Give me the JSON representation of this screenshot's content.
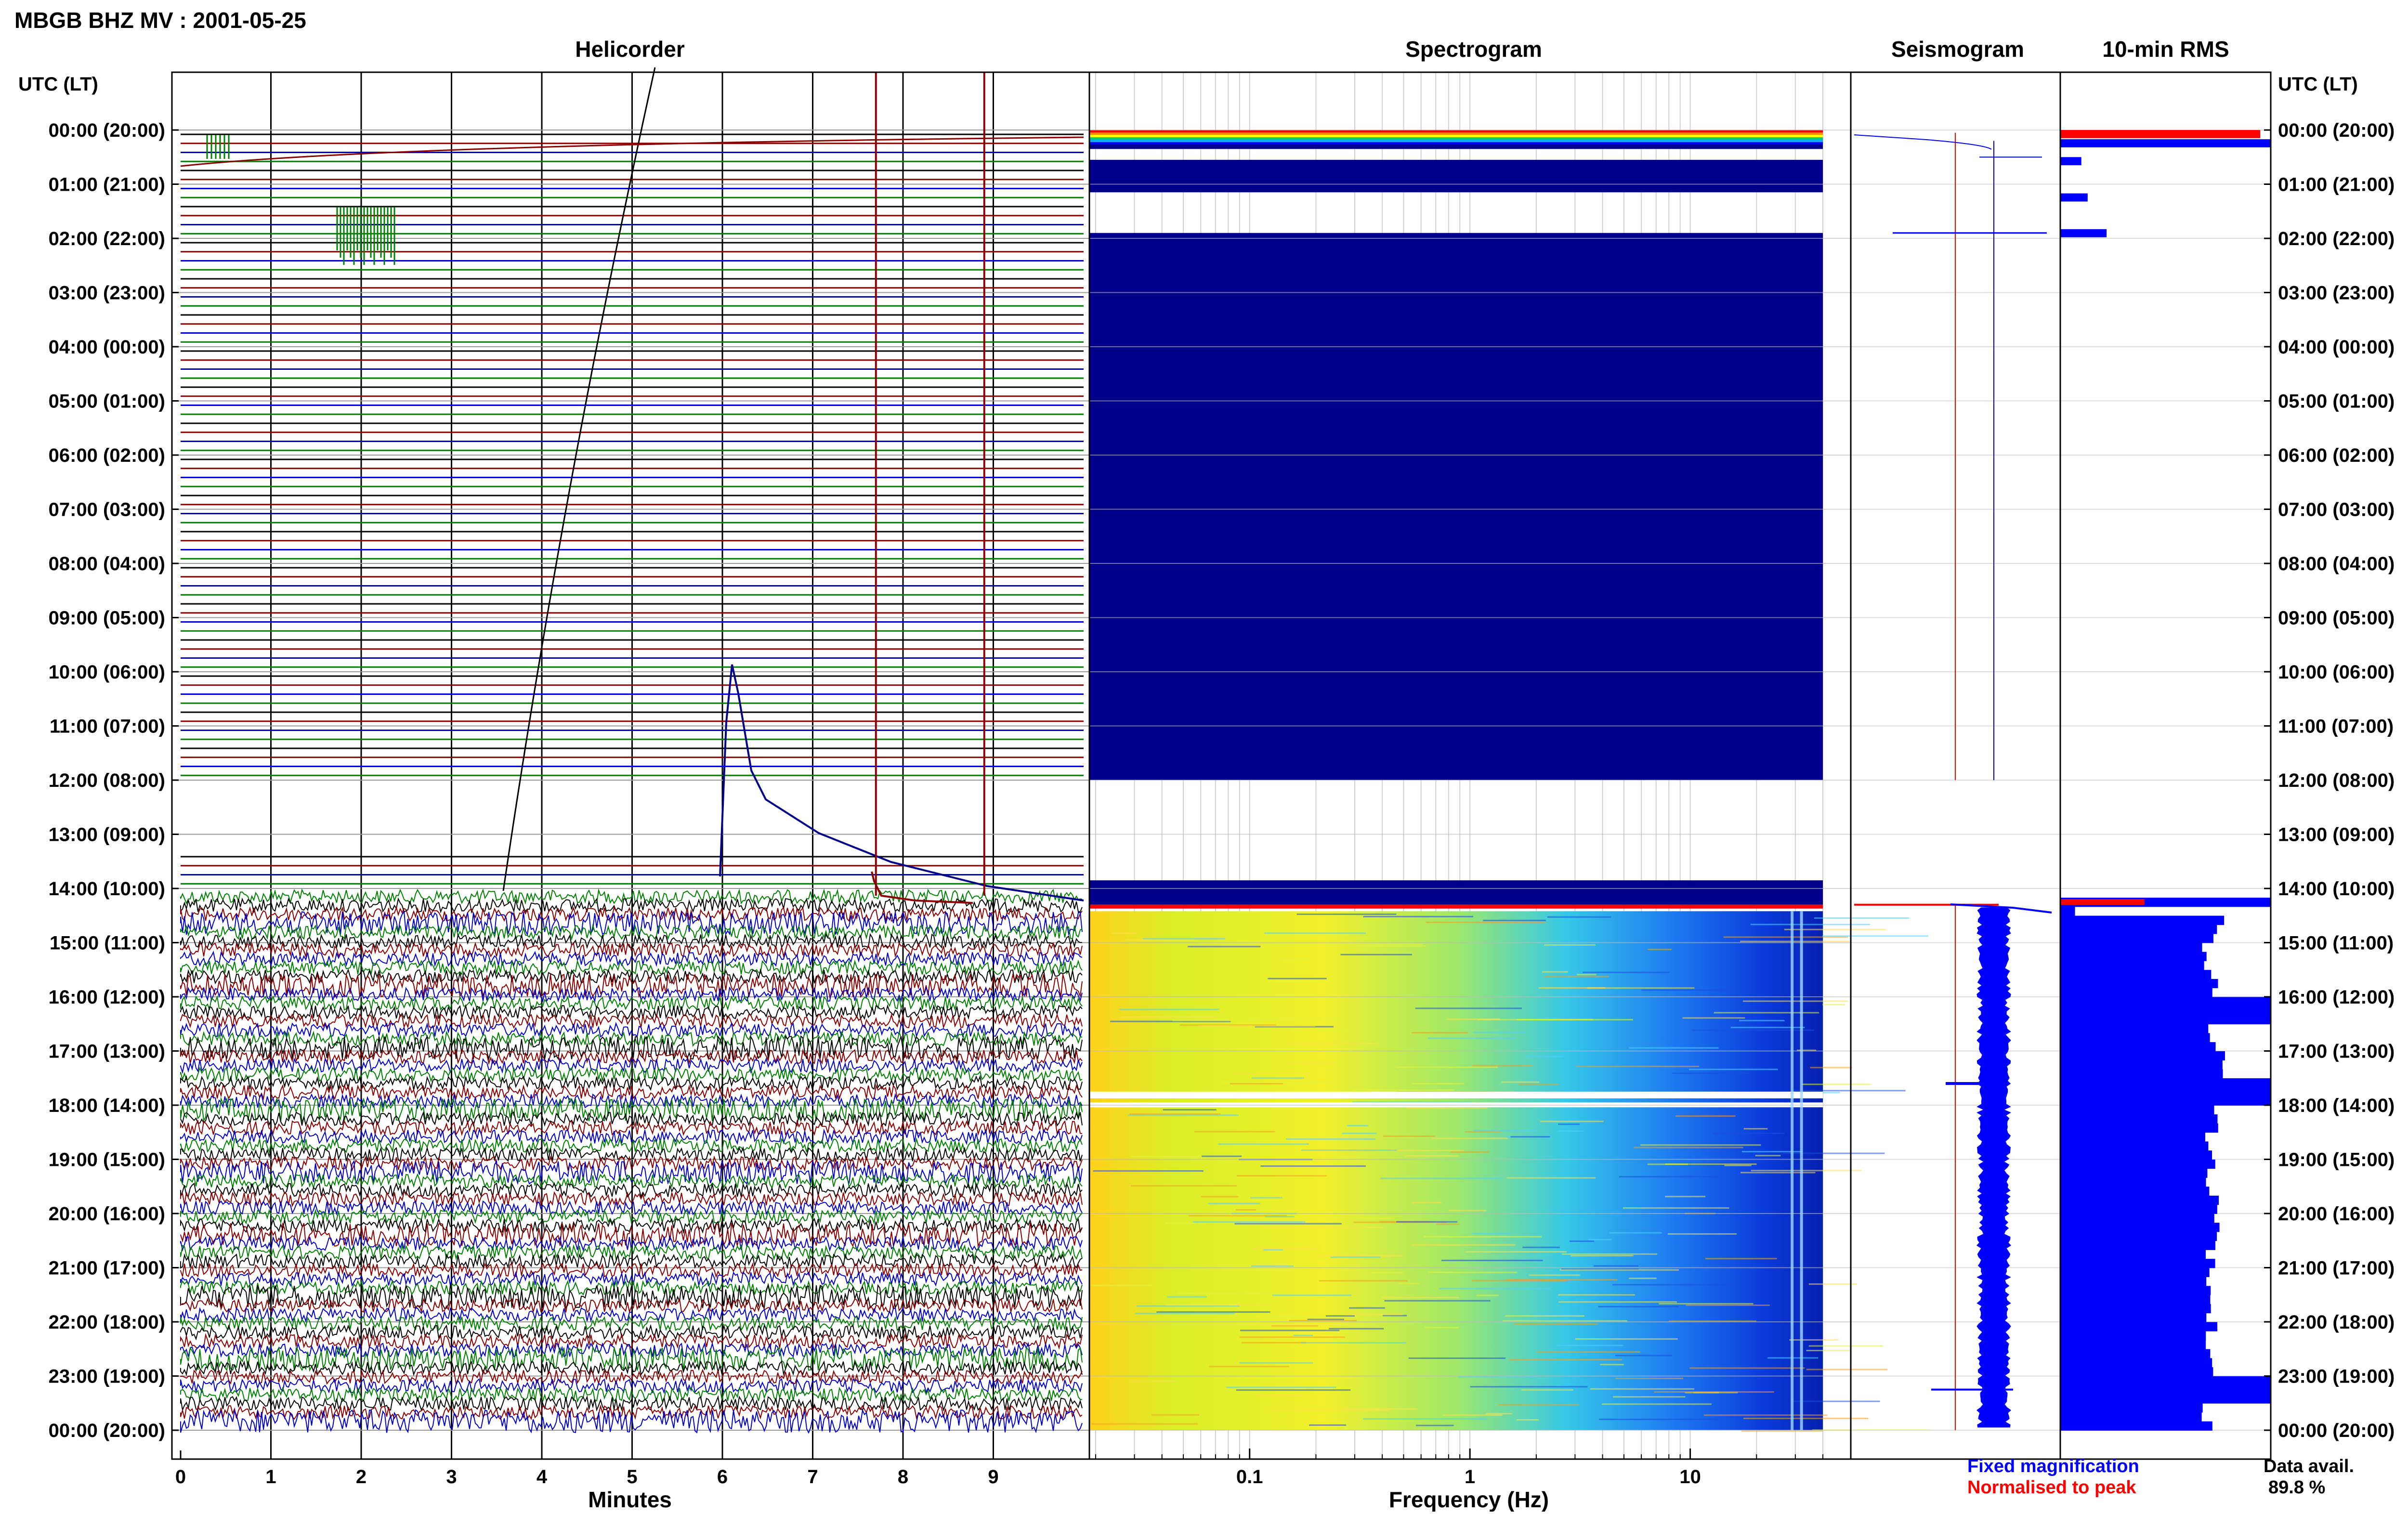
{
  "header": {
    "title": "MBGB BHZ MV : 2001-05-25"
  },
  "panels": {
    "helicorder": "Helicorder",
    "spectrogram": "Spectrogram",
    "seismogram": "Seismogram",
    "rms": "10-min RMS"
  },
  "axes": {
    "left_header": "UTC (LT)",
    "right_header": "UTC (LT)",
    "helicorder_xlabel": "Minutes",
    "spectrogram_xlabel": "Frequency (Hz)"
  },
  "legend": {
    "fixed": "Fixed magnification",
    "normalised": "Normalised to peak",
    "fixed_color": "#0000ff",
    "normalised_color": "#ff0000"
  },
  "data_avail": {
    "label": "Data avail.",
    "value": "89.8 %"
  },
  "colors": {
    "trace_palette": [
      "#000000",
      "#8b0000",
      "#0000cd",
      "#008000"
    ],
    "spectrogram_background": "#00008b",
    "rms_bar": "#0000ff",
    "rms_peak": "#ff0000"
  },
  "chart_data": {
    "time_labels": [
      "00:00 (20:00)",
      "01:00 (21:00)",
      "02:00 (22:00)",
      "03:00 (23:00)",
      "04:00 (00:00)",
      "05:00 (01:00)",
      "06:00 (02:00)",
      "07:00 (03:00)",
      "08:00 (04:00)",
      "09:00 (05:00)",
      "10:00 (06:00)",
      "11:00 (07:00)",
      "12:00 (08:00)",
      "13:00 (09:00)",
      "14:00 (10:00)",
      "15:00 (11:00)",
      "16:00 (12:00)",
      "17:00 (13:00)",
      "18:00 (14:00)",
      "19:00 (15:00)",
      "20:00 (16:00)",
      "21:00 (17:00)",
      "22:00 (18:00)",
      "23:00 (19:00)",
      "00:00 (20:00)"
    ],
    "minute_ticks": [
      "0",
      "1",
      "2",
      "3",
      "4",
      "5",
      "6",
      "7",
      "8",
      "9"
    ],
    "minute_lines": [
      7.7,
      8.9
    ],
    "frequency_ticks": [
      "0.1",
      "1",
      "10"
    ],
    "frequency_range_hz": [
      0.02,
      40
    ],
    "rms_10min": {
      "type": "bar",
      "units": "relative",
      "segments": [
        {
          "hour": 0.0,
          "value": 0.95,
          "color": "red"
        },
        {
          "hour": 0.17,
          "value": 1.0,
          "color": "blue"
        },
        {
          "hour": 0.5,
          "value": 0.1,
          "color": "blue"
        },
        {
          "hour": 1.17,
          "value": 0.13,
          "color": "blue"
        },
        {
          "hour": 1.83,
          "value": 0.22,
          "color": "blue"
        },
        {
          "hour": 14.0,
          "value": 0.4,
          "color": "red"
        },
        {
          "hour": 14.17,
          "value": 1.0,
          "color": "blue"
        },
        {
          "hour": 14.33,
          "value": 0.07,
          "color": "red"
        },
        {
          "hour": 14.5,
          "value": 0.75,
          "color": "blue"
        },
        {
          "hour": 15.0,
          "value": 0.7,
          "color": "blue"
        },
        {
          "hour": 15.5,
          "value": 0.72,
          "color": "blue"
        },
        {
          "hour": 16.0,
          "value": 1.0,
          "color": "blue"
        },
        {
          "hour": 16.5,
          "value": 0.73,
          "color": "blue"
        },
        {
          "hour": 17.0,
          "value": 0.76,
          "color": "blue"
        },
        {
          "hour": 17.5,
          "value": 1.0,
          "color": "blue"
        },
        {
          "hour": 18.0,
          "value": 0.74,
          "color": "blue"
        },
        {
          "hour": 18.5,
          "value": 0.71,
          "color": "blue"
        },
        {
          "hour": 19.0,
          "value": 0.72,
          "color": "blue"
        },
        {
          "hour": 19.5,
          "value": 0.73,
          "color": "blue"
        },
        {
          "hour": 20.0,
          "value": 0.76,
          "color": "blue"
        },
        {
          "hour": 20.5,
          "value": 0.72,
          "color": "blue"
        },
        {
          "hour": 21.0,
          "value": 0.7,
          "color": "blue"
        },
        {
          "hour": 21.5,
          "value": 0.71,
          "color": "blue"
        },
        {
          "hour": 22.0,
          "value": 0.72,
          "color": "blue"
        },
        {
          "hour": 22.5,
          "value": 0.7,
          "color": "blue"
        },
        {
          "hour": 23.0,
          "value": 1.0,
          "color": "blue"
        },
        {
          "hour": 23.5,
          "value": 0.7,
          "color": "blue"
        }
      ]
    }
  }
}
